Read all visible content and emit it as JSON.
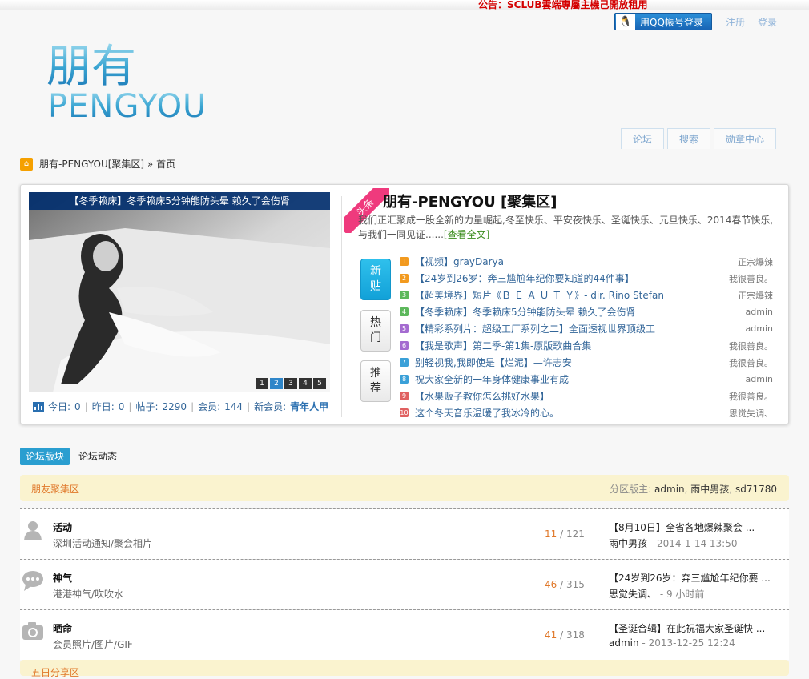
{
  "notice": "公告：SCLUB雲端專屬主機己開放租用",
  "top_links": {
    "qq_login": "用QQ帳号登录",
    "register": "注册",
    "login": "登录"
  },
  "logo": {
    "cn": "朋有",
    "en": "PENGYOU"
  },
  "nav": [
    "论坛",
    "搜索",
    "勋章中心"
  ],
  "breadcrumb": {
    "site": "朋有-PENGYOU[聚集区]",
    "sep": "»",
    "page": "首页"
  },
  "slideshow": {
    "caption": "【冬季赖床】冬季赖床5分钟能防头晕 赖久了会伤肾",
    "pages": [
      "1",
      "2",
      "3",
      "4",
      "5"
    ],
    "active_page": 2
  },
  "stats": {
    "today_label": "今日:",
    "today": "0",
    "yesterday_label": "昨日:",
    "yesterday": "0",
    "posts_label": "帖子:",
    "posts": "2290",
    "members_label": "会员:",
    "members": "144",
    "newest_label": "新会员:",
    "newest": "青年人甲"
  },
  "headline": {
    "ribbon": "头条",
    "title": "朋有-PENGYOU [聚集区]",
    "desc": "我们正汇聚成一股全新的力量崛起,冬至快乐、平安夜快乐、圣诞快乐、元旦快乐、2014春节快乐,与我们一同见证......",
    "more": "[查看全文]"
  },
  "side_tabs": {
    "new": "新贴",
    "hot": "热门",
    "rec": "推荐"
  },
  "threads": [
    {
      "num": "1",
      "color": "#f29a1f",
      "title": "【视频】grayDarya",
      "author": "正宗爆辣"
    },
    {
      "num": "2",
      "color": "#f29a1f",
      "title": "【24岁到26岁：奔三尴尬年纪你要知道的44件事】",
      "author": "我很善良。"
    },
    {
      "num": "3",
      "color": "#5db85c",
      "title": "【超美境界】短片《Ｂ Ｅ Ａ Ｕ Ｔ Ｙ》- dir. Rino Stefan",
      "author": "正宗爆辣"
    },
    {
      "num": "4",
      "color": "#5db85c",
      "title": "【冬季赖床】冬季赖床5分钟能防头晕 赖久了会伤肾",
      "author": "admin"
    },
    {
      "num": "5",
      "color": "#a46bd0",
      "title": "【精彩系列片：超级工厂系列之二】全面透视世界顶级工",
      "author": "admin"
    },
    {
      "num": "6",
      "color": "#a46bd0",
      "title": "【我是歌声】第二季-第1集-原版歌曲合集",
      "author": "我很善良。"
    },
    {
      "num": "7",
      "color": "#3aa0d8",
      "title": "别轻视我,我即使是【烂泥】—许志安",
      "author": "我很善良。"
    },
    {
      "num": "8",
      "color": "#3aa0d8",
      "title": "祝大家全新的一年身体健康事业有成",
      "author": "admin"
    },
    {
      "num": "9",
      "color": "#e06060",
      "title": "【水果贩子教你怎么挑好水果】",
      "author": "我很善良。"
    },
    {
      "num": "10",
      "color": "#e06060",
      "title": "这个冬天音乐温暖了我冰冷的心。",
      "author": "思觉失调、"
    }
  ],
  "bottom_tabs": {
    "boards": "论坛版块",
    "activity": "论坛动态"
  },
  "category": {
    "title": "朋友聚集区",
    "mods_label": "分区版主:",
    "mods": [
      "admin",
      "雨中男孩",
      "sd71780"
    ]
  },
  "forums": [
    {
      "icon": "person-icon",
      "name": "活动",
      "desc": "深圳活动通知/聚会相片",
      "threads": "11",
      "posts": "121",
      "last_title": "【8月10日】全省各地爆辣聚会 ...",
      "last_user": "雨中男孩",
      "last_time": "2014-1-14 13:50"
    },
    {
      "icon": "chat-icon",
      "name": "神气",
      "desc": "港港神气/吹吹水",
      "threads": "46",
      "posts": "315",
      "last_title": "【24岁到26岁：奔三尴尬年纪你要 ...",
      "last_user": "思觉失调、",
      "last_time": "9 小时前"
    },
    {
      "icon": "camera-icon",
      "name": "晒命",
      "desc": "会员照片/图片/GIF",
      "threads": "41",
      "posts": "318",
      "last_title": "【圣诞合辑】在此祝福大家圣诞快 ...",
      "last_user": "admin",
      "last_time": "2013-12-25 12:24"
    }
  ],
  "category2": {
    "title": "五日分享区"
  }
}
